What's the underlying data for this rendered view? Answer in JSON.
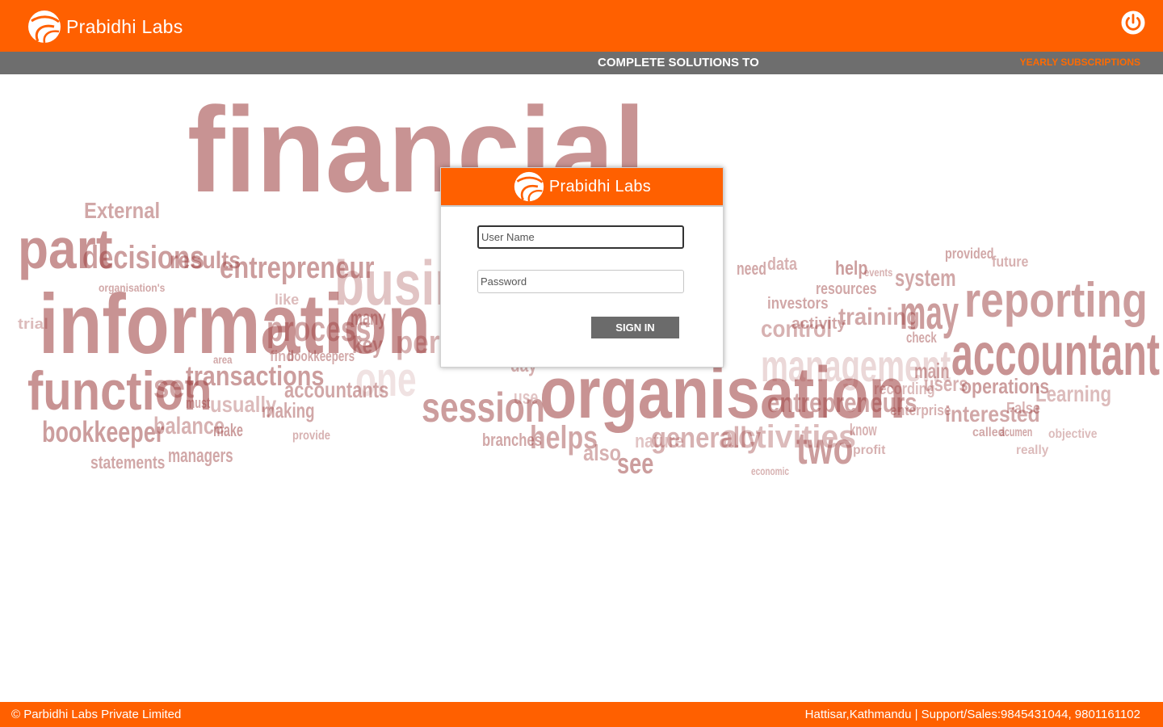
{
  "header": {
    "brand_name": "Prabidhi Labs",
    "power_icon": "power-icon"
  },
  "subbar": {
    "tagline": "COMPLETE SOLUTIONS TO",
    "yearly_link": "YEARLY SUBSCRIPTIONS"
  },
  "hero": {
    "words": [
      "financial",
      "part",
      "External",
      "decisions",
      "results",
      "entrepreneur",
      "business",
      "information",
      "like",
      "process",
      "many",
      "key",
      "perfor",
      "function",
      "set",
      "transactions",
      "accountants",
      "one",
      "session",
      "organisation",
      "bookkeeper",
      "balance",
      "make",
      "managers",
      "usually",
      "making",
      "provide",
      "statements",
      "branches",
      "helps",
      "also",
      "see",
      "nature",
      "generally",
      "activities",
      "two",
      "economic",
      "use",
      "day",
      "control",
      "management",
      "entrepreneurs",
      "recording",
      "enterprise",
      "interested",
      "operations",
      "users",
      "main",
      "check",
      "accountant",
      "reporting",
      "may",
      "system",
      "training",
      "resources",
      "help",
      "investors",
      "need",
      "data",
      "activity",
      "provided",
      "future",
      "Learning",
      "objective",
      "acumen",
      "called",
      "know",
      "profit",
      "really",
      "False",
      "events",
      "bookkeepers",
      "find",
      "area",
      "must",
      "organisation's",
      "trial"
    ]
  },
  "login": {
    "brand_name": "Prabidhi Labs",
    "username_placeholder": "User Name",
    "username_value": "",
    "password_placeholder": "Password",
    "password_value": "",
    "signin_label": "SIGN IN"
  },
  "footer": {
    "copyright": "© Parbidhi Labs Private Limited",
    "contact": "Hattisar,Kathmandu | Support/Sales:9845431044, 9801161102"
  },
  "colors": {
    "brand_orange": "#ff6000",
    "subbar_gray": "#6e6e6e",
    "button_gray": "#6b6b6b",
    "wordcloud_red": "#9a3b3b"
  }
}
